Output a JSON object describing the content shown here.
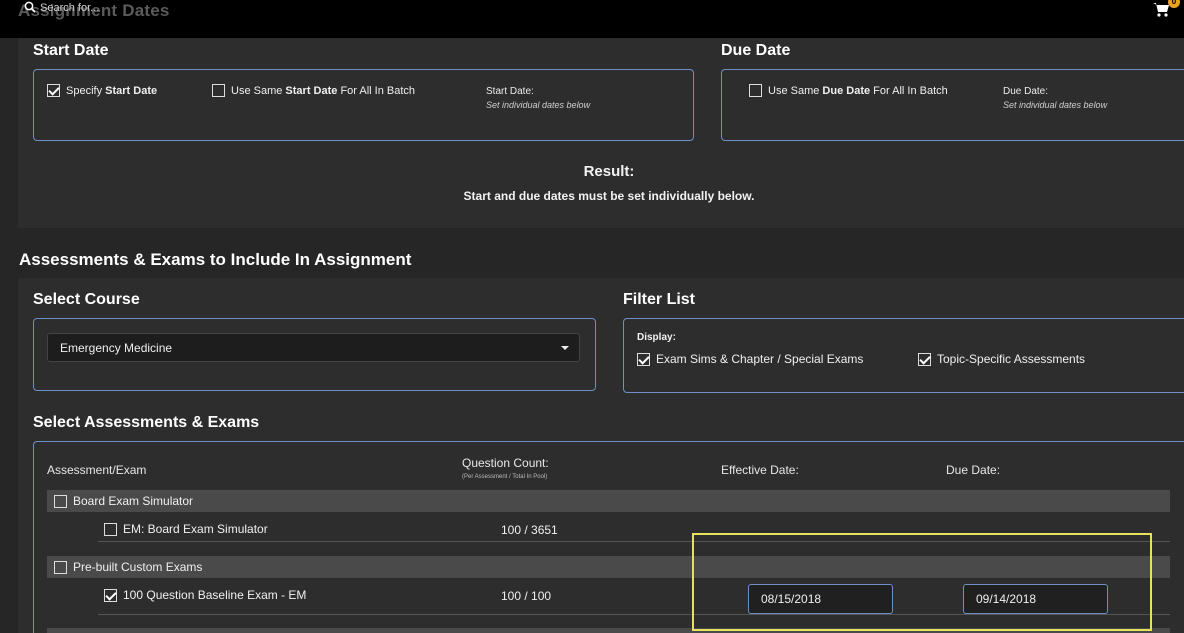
{
  "topbar": {
    "ghost_title": "Assignment Dates",
    "search_placeholder": "Search for...",
    "cart_badge": "0"
  },
  "start_date": {
    "heading": "Start Date",
    "specify_prefix": "Specify ",
    "specify_bold": "Start Date",
    "same_prefix": "Use Same ",
    "same_bold": "Start Date",
    "same_suffix": " For All In Batch",
    "label": "Start Date:",
    "note": "Set individual dates below"
  },
  "due_date": {
    "heading": "Due Date",
    "same_prefix": "Use Same ",
    "same_bold": "Due Date",
    "same_suffix": " For All In Batch",
    "label": "Due Date:",
    "note": "Set individual dates below"
  },
  "result": {
    "title": "Result:",
    "text": "Start and due dates must be set individually below."
  },
  "assessments": {
    "heading": "Assessments & Exams to Include In Assignment",
    "select_course_heading": "Select Course",
    "course_value": "Emergency Medicine",
    "filter_heading": "Filter List",
    "display_label": "Display:",
    "filter_options": [
      {
        "label": "Exam Sims & Chapter / Special Exams",
        "checked": true
      },
      {
        "label": "Topic-Specific Assessments",
        "checked": true
      }
    ],
    "select_heading": "Select Assessments & Exams",
    "columns": {
      "assessment": "Assessment/Exam",
      "question_count": "Question Count:",
      "question_count_sub": "(Per Assessment / Total In Pool)",
      "effective_date": "Effective Date:",
      "due_date": "Due Date:"
    },
    "groups": [
      {
        "label": "Board Exam Simulator",
        "checked": false,
        "items": [
          {
            "label": "EM: Board Exam Simulator",
            "count": "100 / 3651",
            "checked": false
          }
        ]
      },
      {
        "label": "Pre-built Custom Exams",
        "checked": false,
        "items": [
          {
            "label": "100 Question Baseline Exam - EM",
            "count": "100 / 100",
            "checked": true,
            "effective": "08/15/2018",
            "due": "09/14/2018"
          }
        ]
      }
    ]
  }
}
